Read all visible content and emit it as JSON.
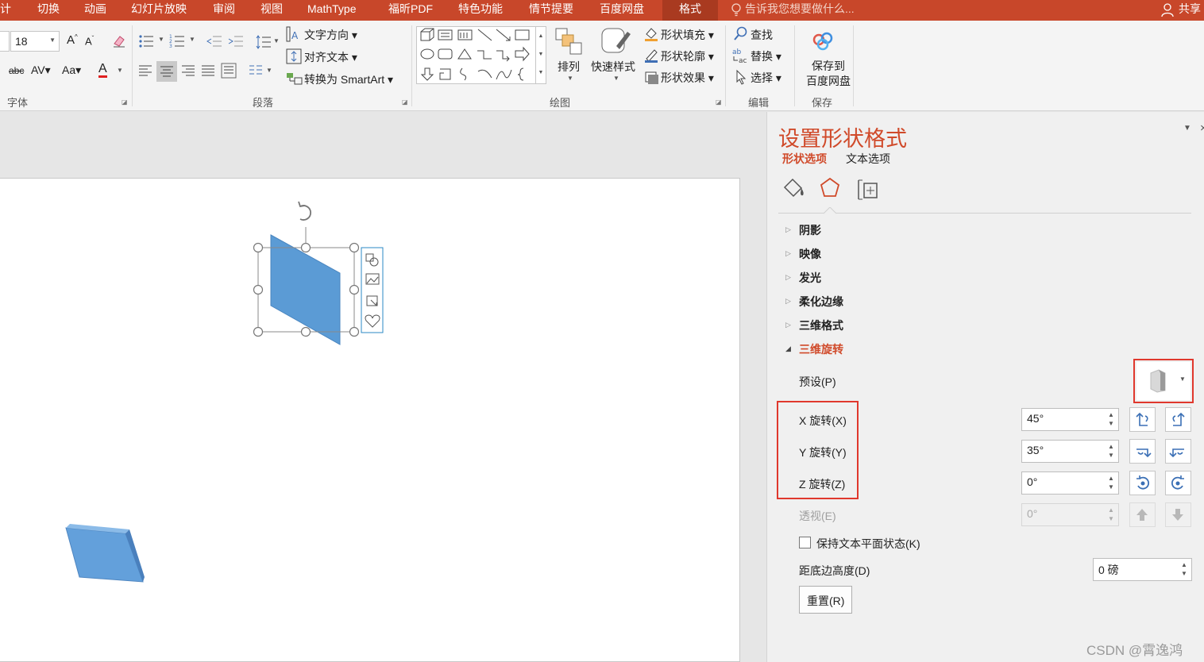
{
  "menu": {
    "tabs": [
      "计",
      "切换",
      "动画",
      "幻灯片放映",
      "审阅",
      "视图",
      "MathType",
      "福昕PDF",
      "特色功能",
      "情节提要",
      "百度网盘",
      "格式"
    ],
    "tell_me": "告诉我您想要做什么...",
    "share": "共享"
  },
  "ribbon": {
    "font": {
      "size": "18",
      "group_label": "字体"
    },
    "paragraph": {
      "text_direction": "文字方向",
      "align_text": "对齐文本",
      "convert_smartart": "转换为 SmartArt",
      "group_label": "段落"
    },
    "drawing": {
      "arrange": "排列",
      "quick_styles": "快速样式",
      "shape_fill": "形状填充",
      "shape_outline": "形状轮廓",
      "shape_effects": "形状效果",
      "group_label": "绘图"
    },
    "editing": {
      "find": "查找",
      "replace": "替换",
      "select": "选择",
      "group_label": "编辑"
    },
    "save": {
      "save_to_baidu": "保存到\n百度网盘",
      "group_label": "保存"
    }
  },
  "pane": {
    "title": "设置形状格式",
    "tabs": {
      "shape_options": "形状选项",
      "text_options": "文本选项"
    },
    "sections": [
      "阴影",
      "映像",
      "发光",
      "柔化边缘",
      "三维格式",
      "三维旋转"
    ],
    "preset_label": "预设(P)",
    "x_rotation": {
      "label": "X 旋转(X)",
      "value": "45°"
    },
    "y_rotation": {
      "label": "Y 旋转(Y)",
      "value": "35°"
    },
    "z_rotation": {
      "label": "Z 旋转(Z)",
      "value": "0°"
    },
    "perspective": {
      "label": "透视(E)",
      "value": "0°"
    },
    "keep_text_flat": "保持文本平面状态(K)",
    "distance_from_ground": {
      "label": "距底边高度(D)",
      "value": "0 磅"
    },
    "reset": "重置(R)"
  },
  "watermark": "CSDN @霄逸鸿",
  "colors": {
    "accent": "#c8472a",
    "shape_blue": "#5b9bd5",
    "highlight_red": "#e0382d"
  }
}
